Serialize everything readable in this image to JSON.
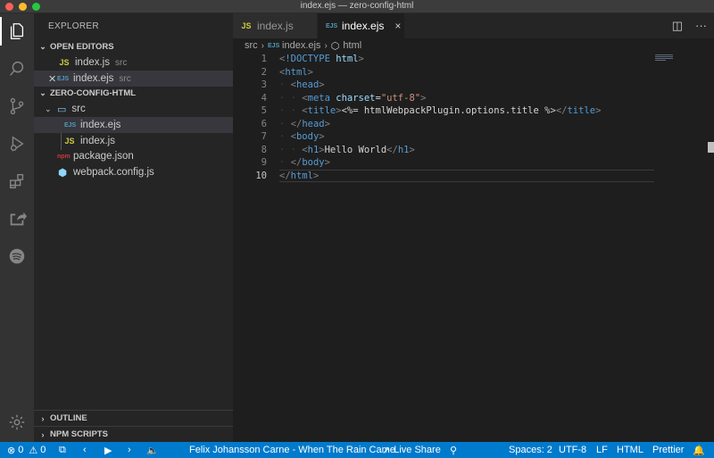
{
  "window": {
    "title": "index.ejs — zero-config-html"
  },
  "activity_bar": {
    "icons": [
      "explorer-icon",
      "search-icon",
      "source-control-icon",
      "run-debug-icon",
      "extensions-icon",
      "live-share-icon",
      "spotify-icon",
      "settings-gear-icon"
    ]
  },
  "sidebar": {
    "title": "EXPLORER",
    "open_editors": {
      "header": "OPEN EDITORS",
      "items": [
        {
          "name": "index.js",
          "desc": "src",
          "icon": "JS"
        },
        {
          "name": "index.ejs",
          "desc": "src",
          "icon": "EJS"
        }
      ]
    },
    "project": {
      "header": "ZERO-CONFIG-HTML",
      "folder": "src",
      "files_in_src": [
        {
          "name": "index.ejs",
          "icon": "EJS"
        },
        {
          "name": "index.js",
          "icon": "JS"
        }
      ],
      "root_files": [
        {
          "name": "package.json",
          "icon": "npm"
        },
        {
          "name": "webpack.config.js",
          "icon": "⬢"
        }
      ]
    },
    "outline_header": "OUTLINE",
    "npm_scripts_header": "NPM SCRIPTS"
  },
  "tabs": [
    {
      "label": "index.js",
      "icon": "JS",
      "active": false
    },
    {
      "label": "index.ejs",
      "icon": "EJS",
      "active": true,
      "close": "×"
    }
  ],
  "breadcrumb": {
    "folder": "src",
    "file": "index.ejs",
    "symbol": "html",
    "file_icon": "EJS"
  },
  "editor": {
    "line_numbers": [
      "1",
      "2",
      "3",
      "4",
      "5",
      "6",
      "7",
      "8",
      "9",
      "10"
    ],
    "lines": [
      "<!DOCTYPE html>",
      "<html>",
      "  <head>",
      "    <meta charset=\"utf-8\">",
      "    <title><%= htmlWebpackPlugin.options.title %></title>",
      "  </head>",
      "  <body>",
      "    <h1>Hello World</h1>",
      "  </body>",
      "</html>"
    ]
  },
  "statusbar": {
    "errors": "0",
    "warnings": "0",
    "track": "Felix Johansson Carne - When The Rain Came",
    "live_share": "Live Share",
    "spaces": "Spaces: 2",
    "encoding": "UTF-8",
    "eol": "LF",
    "language": "HTML",
    "formatter": "Prettier"
  },
  "colors": {
    "accent": "#007acc",
    "activity_bar": "#333333",
    "sidebar": "#252526",
    "editor": "#1e1e1e"
  }
}
